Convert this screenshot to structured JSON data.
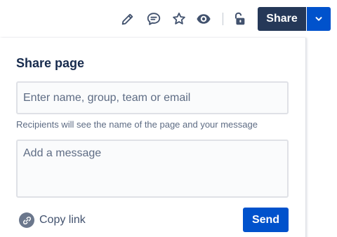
{
  "toolbar": {
    "icons": [
      "edit-icon",
      "comment-icon",
      "star-icon",
      "watch-icon",
      "unlock-icon"
    ],
    "share_label": "Share",
    "share_color": "#253858",
    "dropdown_color": "#0052CC"
  },
  "share_panel": {
    "title": "Share page",
    "recipients_placeholder": "Enter name, group, team or email",
    "hint": "Recipients will see the name of the page and your message",
    "message_placeholder": "Add a message",
    "copy_link_label": "Copy link",
    "send_label": "Send",
    "send_color": "#0052CC"
  }
}
